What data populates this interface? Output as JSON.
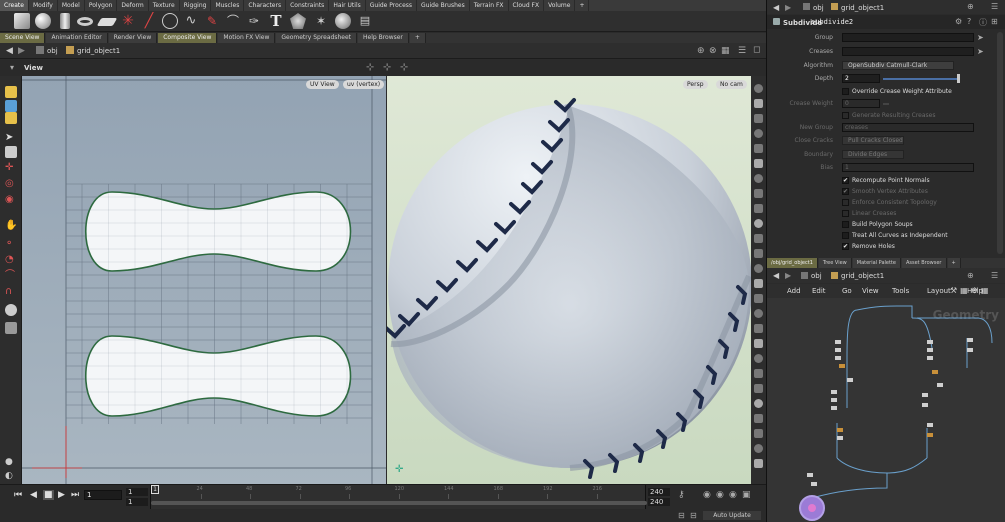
{
  "shelf_tabs": [
    "Create",
    "Modify",
    "Model",
    "Polygon",
    "Deform",
    "Texture",
    "Rigging",
    "Muscles",
    "Characters",
    "Constraints",
    "Hair Utils",
    "Guide Process",
    "Guide Brushes",
    "Terrain FX",
    "Cloud FX",
    "Volume",
    "+"
  ],
  "pane_tabs": [
    "Scene View",
    "Animation Editor",
    "Render View",
    "Composite View",
    "Motion FX View",
    "Geometry Spreadsheet",
    "Help Browser",
    "+"
  ],
  "path": {
    "root": "obj",
    "node": "grid_object1"
  },
  "view_title": "View",
  "uv": {
    "view_btn": "UV View",
    "attr_btn": "uv (vertex)"
  },
  "persp": {
    "persp_btn": "Persp",
    "cam_btn": "No cam"
  },
  "timeline": {
    "frame": "1",
    "start1": "1",
    "start2": "1",
    "end1": "240",
    "end2": "240",
    "ticks": [
      "1",
      "24",
      "48",
      "72",
      "96",
      "120",
      "144",
      "168",
      "192",
      "216"
    ],
    "current": "1",
    "auto_update": "Auto Update"
  },
  "params_path": {
    "root": "obj",
    "node": "grid_object1"
  },
  "node": {
    "type": "Subdivide",
    "name": "subdivide2"
  },
  "params": {
    "group_label": "Group",
    "creases_label": "Creases",
    "algorithm_label": "Algorithm",
    "algorithm_value": "OpenSubdiv Catmull-Clark",
    "depth_label": "Depth",
    "depth_value": "2",
    "override_label": "Override Crease Weight Attribute",
    "crease_weight_label": "Crease Weight",
    "crease_weight_value": "0",
    "gen_creases_label": "Generate Resulting Creases",
    "new_group_label": "New Group",
    "new_group_value": "creases",
    "close_cracks_label": "Close Cracks",
    "close_cracks_value": "Pull Cracks Closed",
    "boundary_label": "Boundary",
    "boundary_value": "Divide Edges",
    "bias_label": "Bias",
    "bias_value": "1",
    "recompute_label": "Recompute Point Normals",
    "smooth_label": "Smooth Vertex Attributes",
    "enforce_label": "Enforce Consistent Topology",
    "linear_label": "Linear Creases",
    "build_label": "Build Polygon Soups",
    "treat_label": "Treat All Curves as Independent",
    "remove_label": "Remove Holes"
  },
  "net_tabs": [
    "/obj/grid_object1",
    "Tree View",
    "Material Palette",
    "Asset Browser",
    "+"
  ],
  "net_path": {
    "root": "obj",
    "node": "grid_object1"
  },
  "net_menu": [
    "Add",
    "Edit",
    "Go",
    "View",
    "Tools",
    "Layout",
    "Help"
  ],
  "net_watermark": "Geometry",
  "colors": {
    "accent": "#6b6b43",
    "uv_outline": "#2d6a3f",
    "stitch": "#1e2a48",
    "node_purple": "#9b7bd6"
  }
}
